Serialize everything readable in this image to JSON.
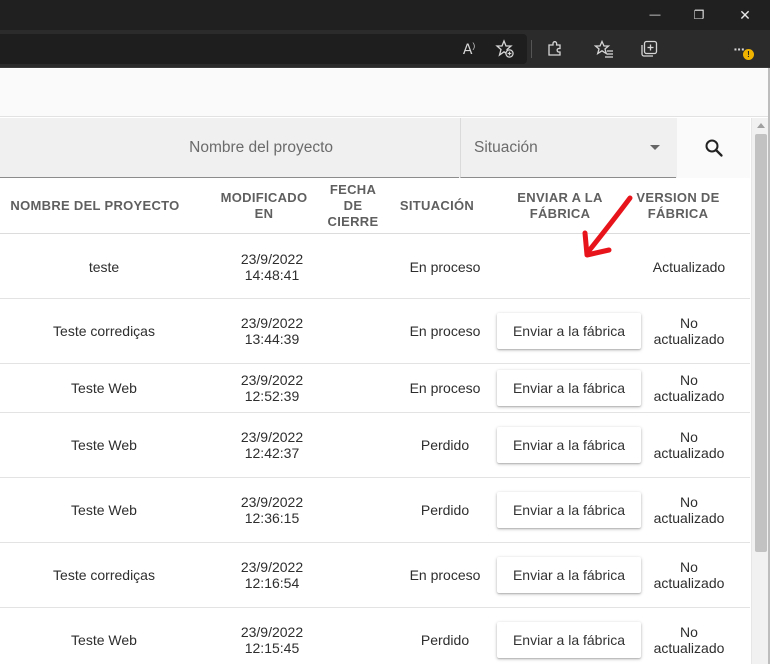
{
  "window": {
    "minimize_glyph": "—",
    "maximize_glyph": "❐",
    "close_glyph": "✕"
  },
  "toolbar": {
    "read_aloud_glyph": "A",
    "menu_glyph": "···",
    "badge": "!"
  },
  "filters": {
    "project_placeholder": "Nombre del proyecto",
    "status_placeholder": "Situación"
  },
  "table": {
    "headers": {
      "name": "NOMBRE DEL PROYECTO",
      "modified": "MODIFICADO EN",
      "close_date": "FECHA DE CIERRE",
      "status": "SITUACIÓN",
      "send": "ENVIAR A LA FÁBRICA",
      "version": "VERSION DE FÁBRICA"
    },
    "rows": [
      {
        "name": "teste",
        "date": "23/9/2022",
        "time": "14:48:41",
        "close_date": "",
        "status": "En proceso",
        "button": "",
        "version": "Actualizado"
      },
      {
        "name": "Teste corrediças",
        "date": "23/9/2022",
        "time": "13:44:39",
        "close_date": "",
        "status": "En proceso",
        "button": "Enviar a la fábrica",
        "version": "No actualizado"
      },
      {
        "name": "Teste Web",
        "date": "23/9/2022",
        "time": "12:52:39",
        "close_date": "",
        "status": "En proceso",
        "button": "Enviar a la fábrica",
        "version": "No actualizado"
      },
      {
        "name": "Teste Web",
        "date": "23/9/2022",
        "time": "12:42:37",
        "close_date": "",
        "status": "Perdido",
        "button": "Enviar a la fábrica",
        "version": "No actualizado"
      },
      {
        "name": "Teste Web",
        "date": "23/9/2022",
        "time": "12:36:15",
        "close_date": "",
        "status": "Perdido",
        "button": "Enviar a la fábrica",
        "version": "No actualizado"
      },
      {
        "name": "Teste corrediças",
        "date": "23/9/2022",
        "time": "12:16:54",
        "close_date": "",
        "status": "En proceso",
        "button": "Enviar a la fábrica",
        "version": "No actualizado"
      },
      {
        "name": "Teste Web",
        "date": "23/9/2022",
        "time": "12:15:45",
        "close_date": "",
        "status": "Perdido",
        "button": "Enviar a la fábrica",
        "version": "No actualizado"
      }
    ]
  },
  "colors": {
    "annotation_arrow": "#e8141c",
    "titlebar": "#202020",
    "toolbar": "#2b2b2b"
  }
}
